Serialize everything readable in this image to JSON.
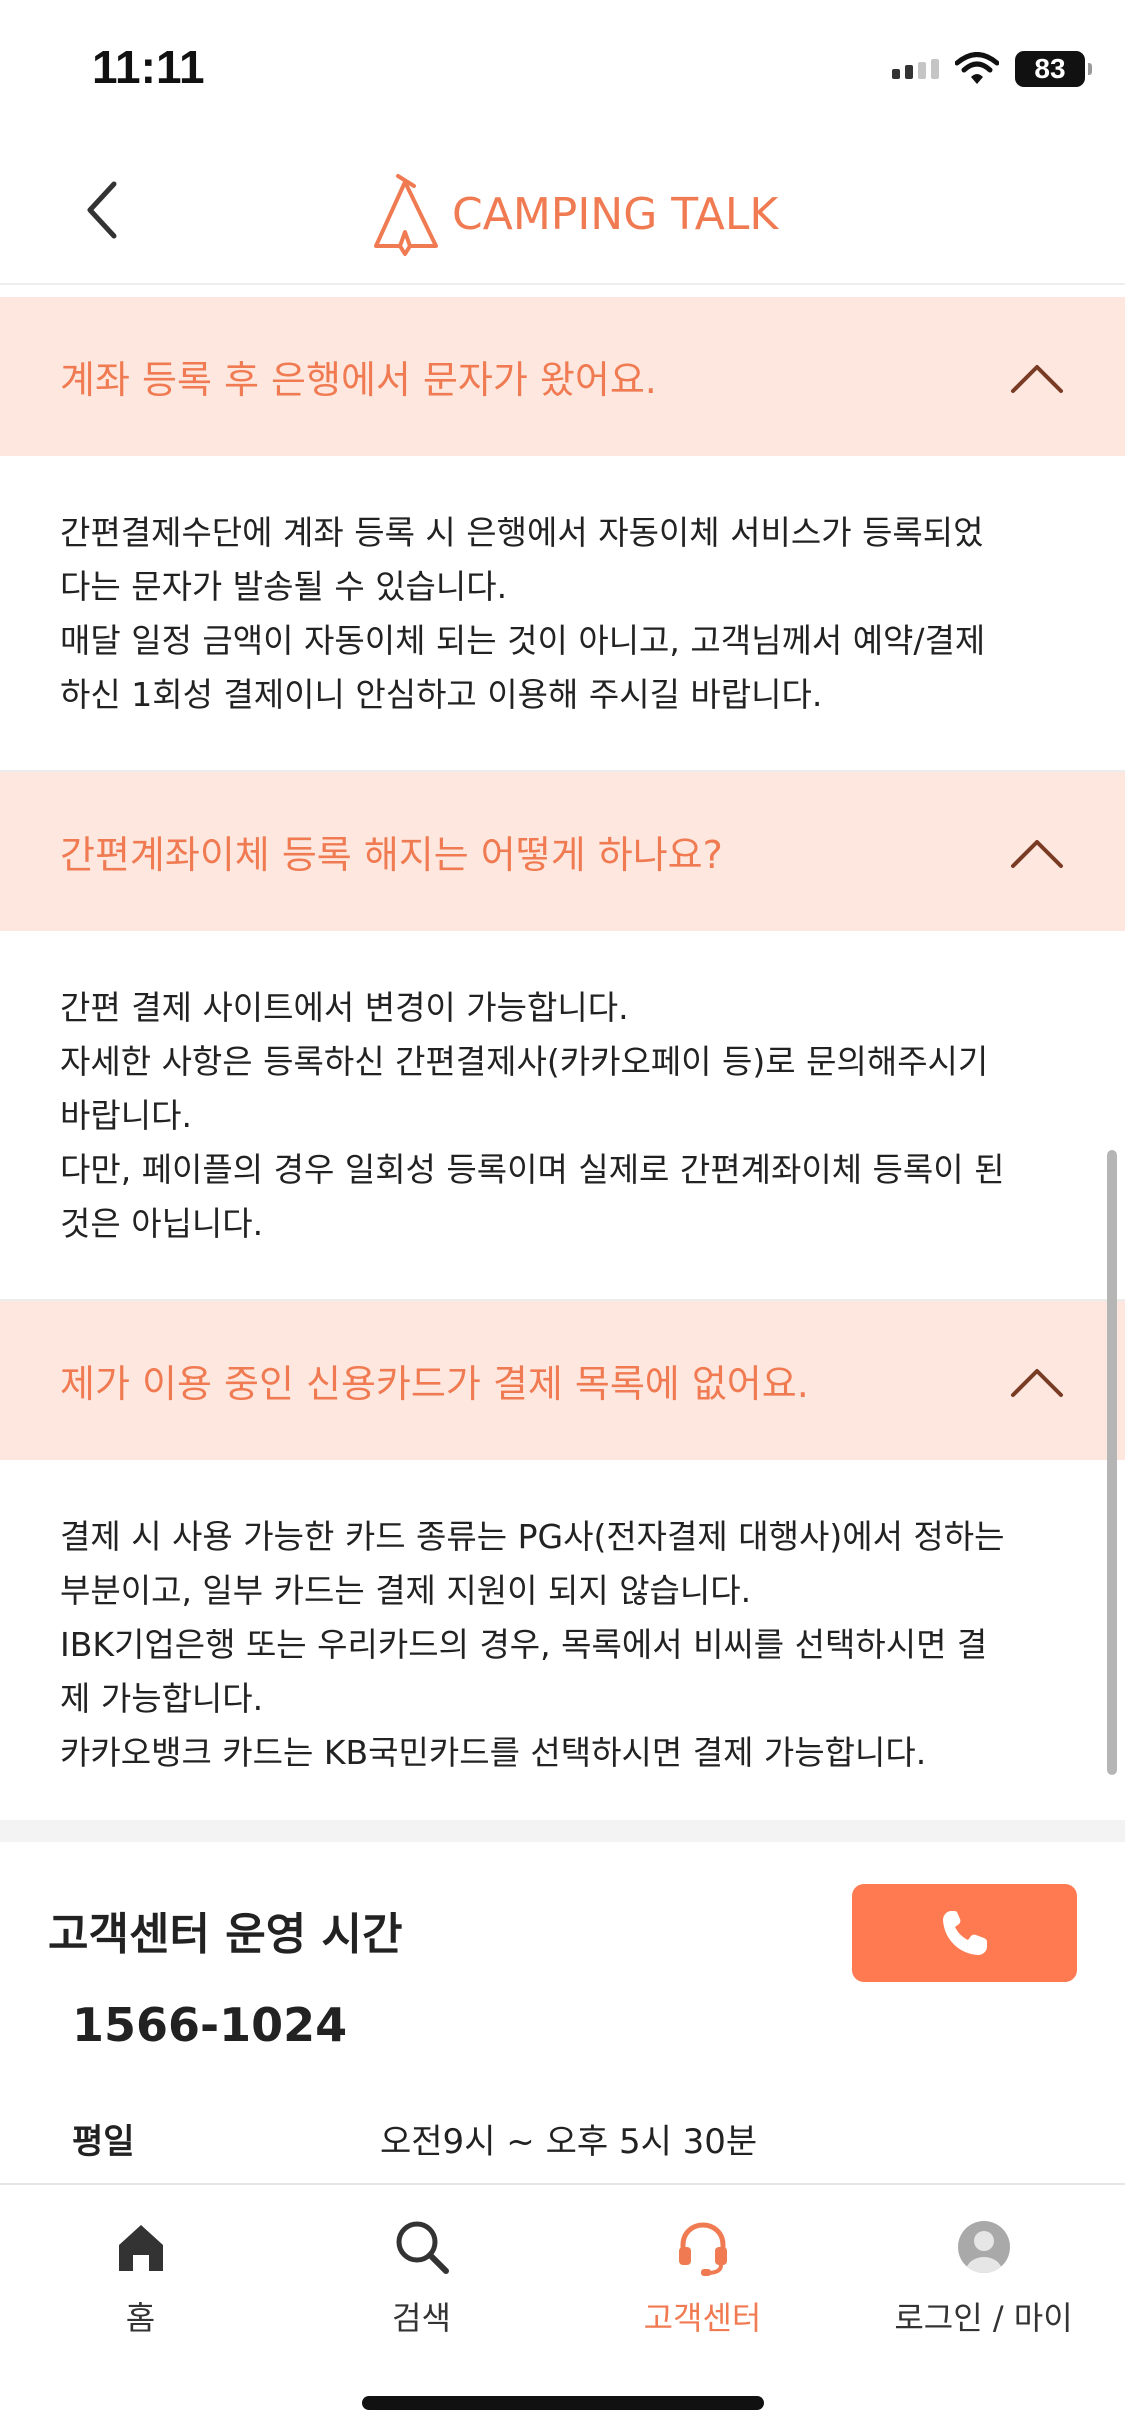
{
  "status_bar": {
    "time": "11:11",
    "battery": "83"
  },
  "header": {
    "logo_text": "CAMPING TALK"
  },
  "faq": [
    {
      "question": "계좌 등록 후 은행에서 문자가 왔어요.",
      "answer_lines": [
        "간편결제수단에 계좌 등록 시 은행에서 자동이체 서비스가 등록되었",
        "다는 문자가 발송될 수 있습니다.",
        "매달 일정 금액이 자동이체 되는 것이 아니고, 고객님께서 예약/결제",
        "하신 1회성 결제이니 안심하고 이용해 주시길 바랍니다."
      ]
    },
    {
      "question": "간편계좌이체 등록 해지는 어떻게 하나요?",
      "answer_lines": [
        "간편 결제 사이트에서 변경이 가능합니다.",
        "자세한 사항은 등록하신 간편결제사(카카오페이 등)로 문의해주시기",
        "바랍니다.",
        "다만, 페이플의 경우 일회성 등록이며 실제로 간편계좌이체 등록이 된",
        "것은 아닙니다."
      ]
    },
    {
      "question": "제가 이용 중인 신용카드가 결제 목록에 없어요.",
      "answer_lines": [
        "결제 시 사용 가능한 카드 종류는 PG사(전자결제 대행사)에서 정하는",
        "부분이고, 일부 카드는 결제 지원이 되지 않습니다.",
        "IBK기업은행 또는 우리카드의 경우, 목록에서 비씨를 선택하시면 결",
        "제 가능합니다.",
        "카카오뱅크 카드는 KB국민카드를 선택하시면 결제 가능합니다."
      ]
    }
  ],
  "customer_center": {
    "title": "고객센터 운영 시간",
    "phone": "1566-1024",
    "hours_label": "평일",
    "hours_value": "오전9시 ~ 오후 5시 30분"
  },
  "tabs": [
    {
      "label": "홈",
      "icon": "home-icon"
    },
    {
      "label": "검색",
      "icon": "search-icon"
    },
    {
      "label": "고객센터",
      "icon": "headset-icon",
      "active": true
    },
    {
      "label": "로그인 / 마이",
      "icon": "avatar-icon"
    }
  ],
  "colors": {
    "accent": "#f07b52",
    "question_bg": "#fde7df",
    "call_button": "#ff7a50"
  }
}
